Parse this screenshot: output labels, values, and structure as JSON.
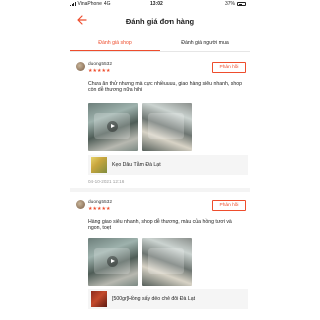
{
  "status_bar": {
    "carrier": "VinaPhone",
    "network": "4G",
    "time": "13:02",
    "battery": "37%"
  },
  "header": {
    "title": "Đánh giá đơn hàng"
  },
  "tabs": [
    {
      "label": "Đánh giá shop",
      "active": true
    },
    {
      "label": "Đánh giá người mua",
      "active": false
    }
  ],
  "accent_color": "#ee4d2d",
  "reviews": [
    {
      "username": "duong5532",
      "rating": 5,
      "stars": "★★★★★",
      "reply_label": "Phản hồi",
      "comment": "Chưa ăn thử nhưng mà cực nhiềuuuu, giao hàng siêu nhanh, shop còn dễ thương nữa hihi",
      "product": "Kẹo Dâu Tằm Đà Lạt",
      "date": "04-10-2021 12:16"
    },
    {
      "username": "duong5532",
      "rating": 5,
      "stars": "★★★★★",
      "reply_label": "Phản hồi",
      "comment": "Hàng giao siêu nhanh, shop dễ thương, màu của hồng tươi và ngon, toẹt",
      "product": "[500gr]Hồng sấy dẻo chẻ đôi Đà Lạt"
    }
  ]
}
